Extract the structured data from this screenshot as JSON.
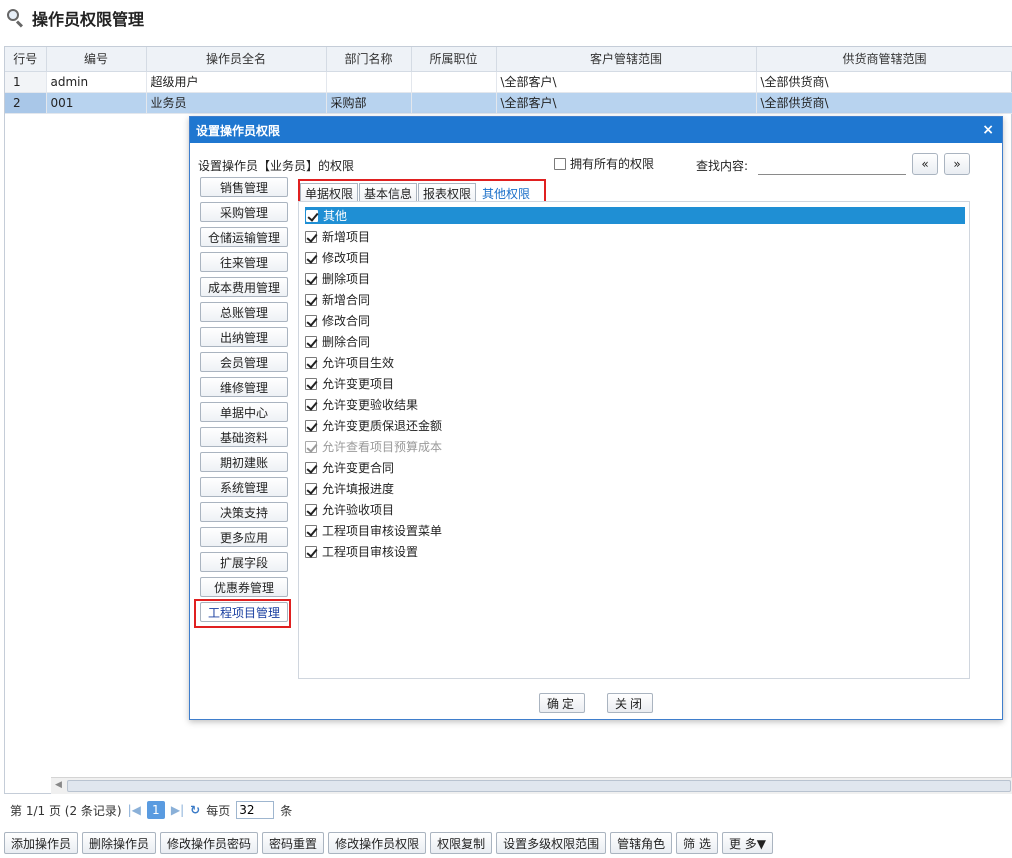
{
  "page": {
    "title": "操作员权限管理"
  },
  "grid": {
    "columns": [
      "行号",
      "编号",
      "操作员全名",
      "部门名称",
      "所属职位",
      "客户管辖范围",
      "供货商管辖范围"
    ],
    "rows": [
      [
        "1",
        "admin",
        "超级用户",
        "",
        "",
        "\\全部客户\\",
        "\\全部供货商\\"
      ],
      [
        "2",
        "001",
        "业务员",
        "采购部",
        "",
        "\\全部客户\\",
        "\\全部供货商\\"
      ]
    ],
    "selected_row": 2
  },
  "pager": {
    "page_info": "第  1/1 页  (2 条记录)",
    "current_page": "1",
    "per_page_label": "每页",
    "per_page_value": "32",
    "unit": "条"
  },
  "toolbar": {
    "buttons": [
      "添加操作员",
      "删除操作员",
      "修改操作员密码",
      "密码重置",
      "修改操作员权限",
      "权限复制",
      "设置多级权限范围",
      "管辖角色",
      "筛 选",
      "更 多▼"
    ]
  },
  "dialog": {
    "title": "设置操作员权限",
    "subtitle": "设置操作员【业务员】的权限",
    "all_perm_label": "拥有所有的权限",
    "search_label": "查找内容:",
    "search_value": "",
    "prev_label": "«",
    "next_label": "»",
    "menu": [
      "销售管理",
      "采购管理",
      "仓储运输管理",
      "往来管理",
      "成本费用管理",
      "总账管理",
      "出纳管理",
      "会员管理",
      "维修管理",
      "单据中心",
      "基础资料",
      "期初建账",
      "系统管理",
      "决策支持",
      "更多应用",
      "扩展字段",
      "优惠券管理",
      "工程项目管理"
    ],
    "active_menu": "工程项目管理",
    "tabs": [
      "单据权限",
      "基本信息",
      "报表权限",
      "其他权限"
    ],
    "active_tab": "其他权限",
    "perm_header": "其他",
    "permissions": [
      {
        "label": "新增项目",
        "checked": true,
        "disabled": false
      },
      {
        "label": "修改项目",
        "checked": true,
        "disabled": false
      },
      {
        "label": "删除项目",
        "checked": true,
        "disabled": false
      },
      {
        "label": "新增合同",
        "checked": true,
        "disabled": false
      },
      {
        "label": "修改合同",
        "checked": true,
        "disabled": false
      },
      {
        "label": "删除合同",
        "checked": true,
        "disabled": false
      },
      {
        "label": "允许项目生效",
        "checked": true,
        "disabled": false
      },
      {
        "label": "允许变更项目",
        "checked": true,
        "disabled": false
      },
      {
        "label": "允许变更验收结果",
        "checked": true,
        "disabled": false
      },
      {
        "label": "允许变更质保退还金额",
        "checked": true,
        "disabled": false
      },
      {
        "label": "允许查看项目预算成本",
        "checked": true,
        "disabled": true
      },
      {
        "label": "允许变更合同",
        "checked": true,
        "disabled": false
      },
      {
        "label": "允许填报进度",
        "checked": true,
        "disabled": false
      },
      {
        "label": "允许验收项目",
        "checked": true,
        "disabled": false
      },
      {
        "label": "工程项目审核设置菜单",
        "checked": true,
        "disabled": false
      },
      {
        "label": "工程项目审核设置",
        "checked": true,
        "disabled": false
      }
    ],
    "ok_label": "确定",
    "close_label": "关闭"
  },
  "colors": {
    "accent": "#1f77d0",
    "highlight": "#e02020",
    "row_selected": "#b8d3ef"
  }
}
